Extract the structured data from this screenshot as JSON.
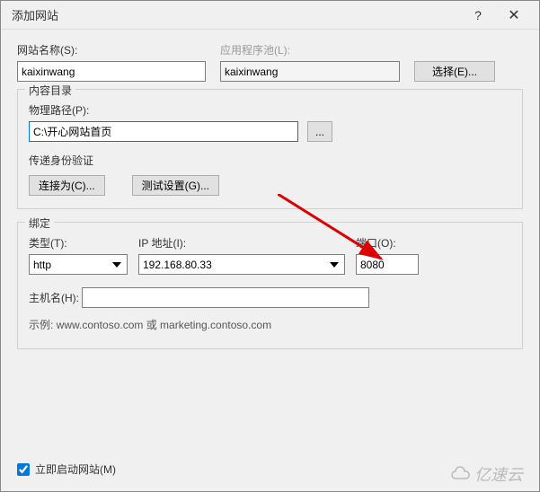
{
  "title": "添加网站",
  "labels": {
    "site_name": "网站名称(S):",
    "app_pool": "应用程序池(L):",
    "select_btn": "选择(E)...",
    "content_dir": "内容目录",
    "phys_path": "物理路径(P):",
    "browse_dots": "...",
    "pass_auth": "传递身份验证",
    "connect_as": "连接为(C)...",
    "test_settings": "测试设置(G)...",
    "binding": "绑定",
    "type": "类型(T):",
    "ip": "IP 地址(I):",
    "port": "端口(O):",
    "hostname": "主机名(H):",
    "example": "示例: www.contoso.com 或 marketing.contoso.com",
    "autostart": "立即启动网站(M)"
  },
  "values": {
    "site_name": "kaixinwang",
    "app_pool": "kaixinwang",
    "phys_path": "C:\\开心网站首页",
    "type": "http",
    "ip": "192.168.80.33",
    "port": "8080",
    "hostname": "",
    "autostart_checked": true
  },
  "watermark": "亿速云"
}
